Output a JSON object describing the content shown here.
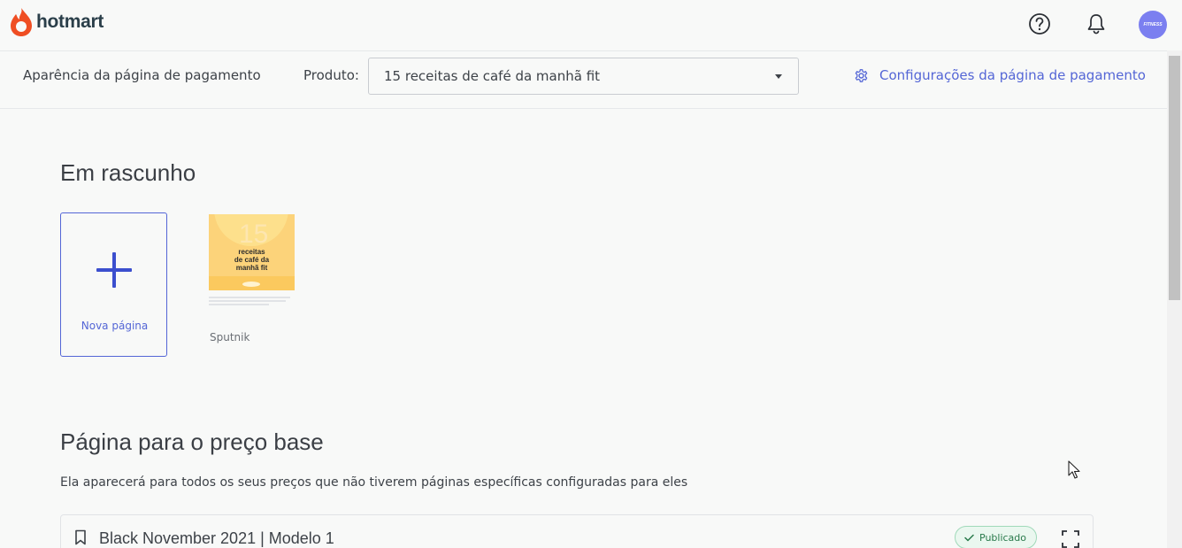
{
  "header": {
    "logo_text": "hotmart",
    "avatar_text": "FITNESS",
    "icons": [
      "help-icon",
      "bell-icon"
    ]
  },
  "subbar": {
    "title": "Aparência da página de pagamento",
    "product_label": "Produto:",
    "product_value": "15 receitas de café da manhã fit",
    "config_link": "Configurações da página de pagamento"
  },
  "drafts": {
    "heading": "Em rascunho",
    "new_page_label": "Nova página",
    "template": {
      "number": "15",
      "line1": "receitas",
      "line2": "de café da",
      "line3": "manhã fit",
      "label": "Sputnik"
    }
  },
  "base_price": {
    "heading": "Página para o preço base",
    "description": "Ela aparecerá para todos os seus preços que não tiverem páginas específicas configuradas para eles",
    "card": {
      "title": "Black November 2021 | Modelo 1",
      "status": "Publicado"
    }
  },
  "colors": {
    "accent": "#5466d6",
    "logo": "#ef4e23",
    "published_green": "#2a7a4c"
  }
}
